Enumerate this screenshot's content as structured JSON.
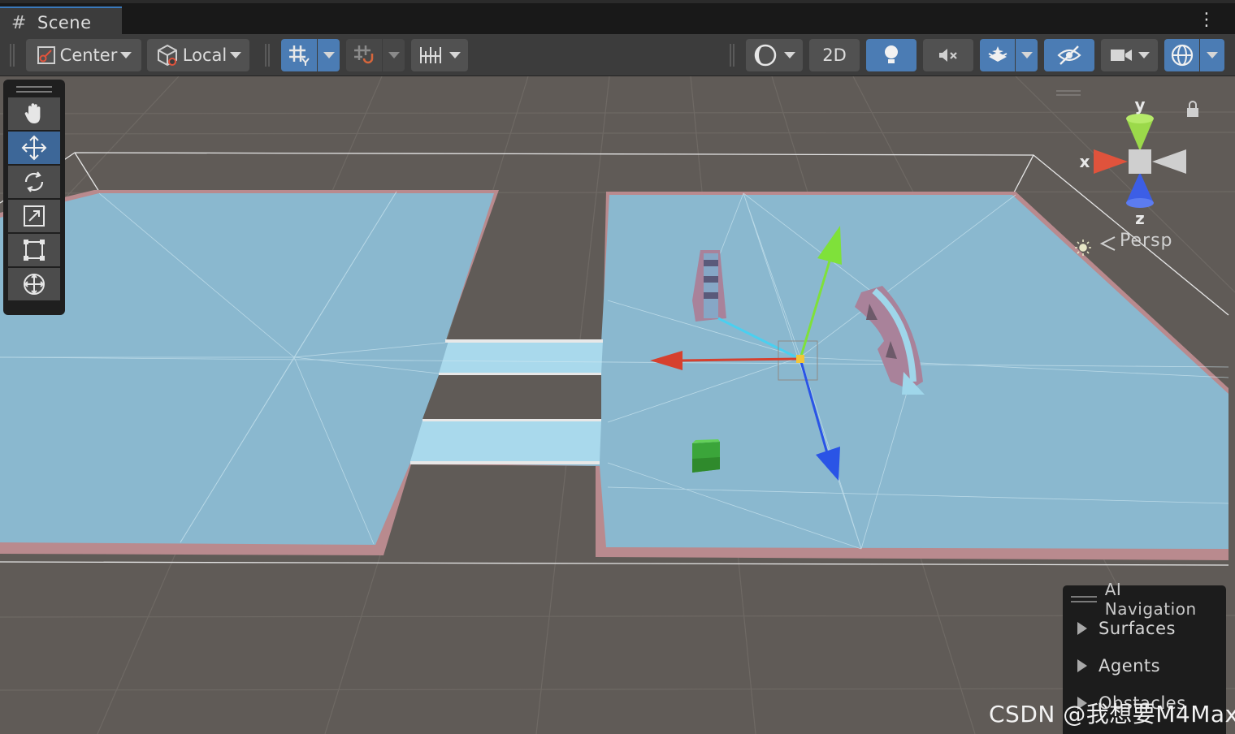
{
  "tab": {
    "label": "Scene",
    "icon": "grid-icon"
  },
  "toolbar": {
    "pivot_label": "Center",
    "space_label": "Local",
    "mode_2d_label": "2D",
    "icons": [
      "pivot-center-icon",
      "local-space-icon",
      "grid-toggle-icon",
      "grid-snap-icon",
      "increment-snap-icon",
      "draw-mode-icon",
      "lighting-icon",
      "audio-mute-icon",
      "effects-icon",
      "hidden-objects-icon",
      "camera-icon",
      "gizmos-icon"
    ]
  },
  "tools": [
    "hand-tool",
    "move-tool",
    "rotate-tool",
    "scale-tool",
    "rect-tool",
    "transform-tool"
  ],
  "active_tool": "move-tool",
  "gizmo": {
    "y_label": "y",
    "x_label": "x",
    "z_label": "z",
    "projection_label": "Persp"
  },
  "ai_navigation": {
    "title": "AI Navigation",
    "items": [
      "Surfaces",
      "Agents",
      "Obstacles"
    ]
  },
  "watermark": "CSDN @我想要M4Max",
  "colors": {
    "background": "#605b57",
    "navmesh": "#8ab8cf",
    "navmesh_border": "#b98a8e",
    "toolbar": "#3c3c3c",
    "active_button": "#4b7cb4",
    "axis_x": "#d6402e",
    "axis_y": "#7fe13a",
    "axis_z": "#2a54e6"
  }
}
